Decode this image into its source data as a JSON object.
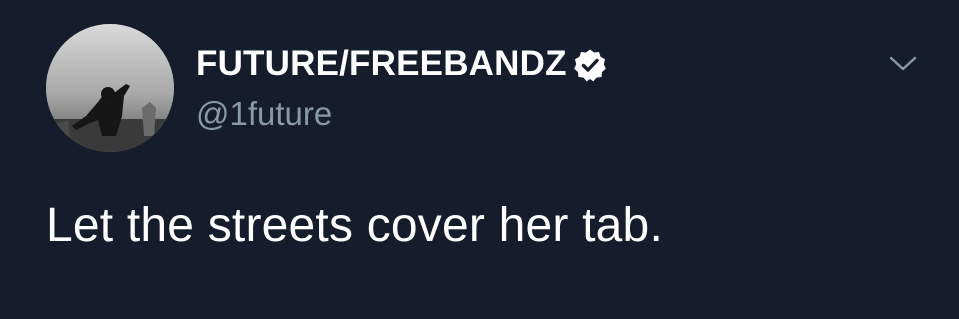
{
  "tweet": {
    "display_name": "FUTURE/FREEBANDZ",
    "handle": "@1future",
    "text": "Let the streets cover her tab.",
    "avatar_icon": "profile-photo",
    "verified_icon": "verified-badge-icon",
    "menu_icon": "chevron-down-icon"
  },
  "colors": {
    "background": "#151c2b",
    "name": "#ffffff",
    "handle": "#8899a6",
    "text": "#ffffff",
    "chevron": "#8899a6"
  }
}
